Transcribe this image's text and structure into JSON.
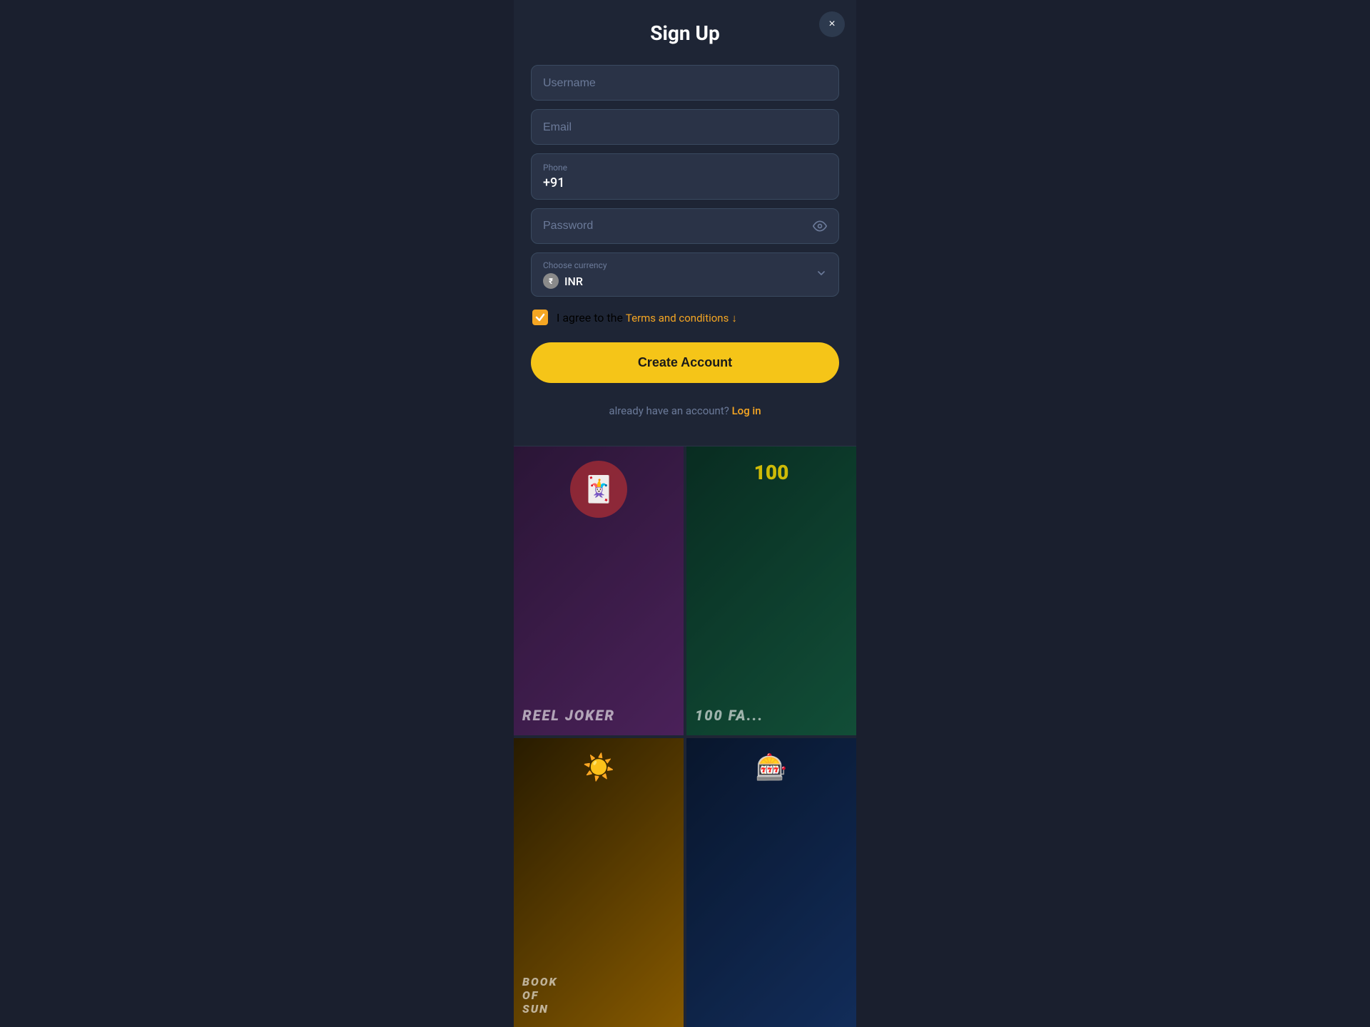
{
  "modal": {
    "title": "Sign Up",
    "close_label": "×",
    "fields": {
      "username_placeholder": "Username",
      "email_placeholder": "Email",
      "phone_label": "Phone",
      "phone_value": "+91",
      "password_placeholder": "Password",
      "currency_label": "Choose currency",
      "currency_value": "INR",
      "currency_icon": "₹"
    },
    "terms": {
      "text_before": "I agree to the ",
      "link_text": "Terms and conditions",
      "download_icon": "↓"
    },
    "create_button_label": "Create Account",
    "login_text": "already have an account?",
    "login_link": "Log in"
  },
  "games": [
    {
      "title": "REEL JOKER",
      "id": "reel-joker"
    },
    {
      "title": "100 FA...",
      "id": "100-fa"
    },
    {
      "title": "BOOK OF SUN",
      "id": "book-of-sun"
    },
    {
      "title": "...",
      "id": "game-4"
    }
  ],
  "colors": {
    "accent": "#f5c518",
    "accent_text": "#f5a623",
    "bg_dark": "#1a1f2e",
    "bg_modal": "#1e2535",
    "bg_field": "#2a3347",
    "text_muted": "#6b7a99",
    "close_bg": "#2d3a4e"
  }
}
